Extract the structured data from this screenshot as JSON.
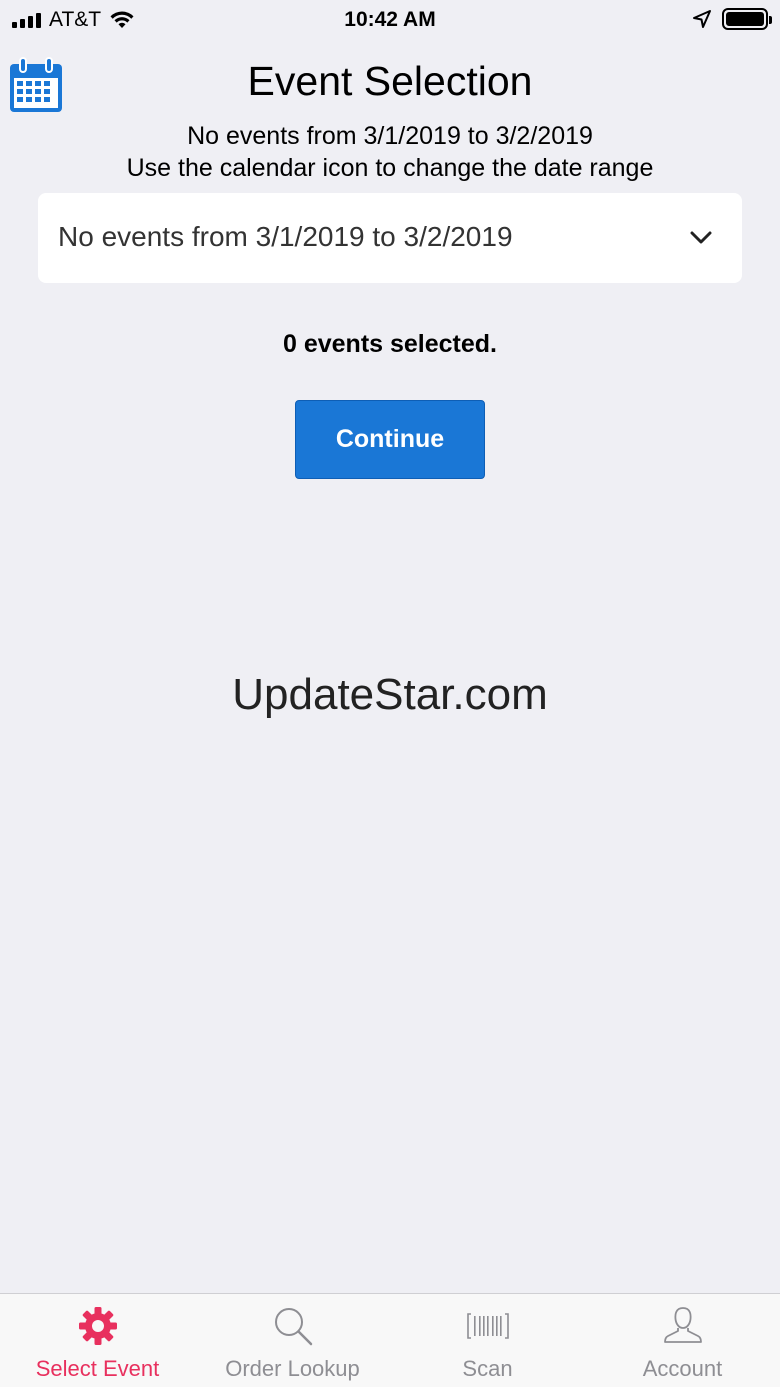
{
  "status_bar": {
    "carrier": "AT&T",
    "time": "10:42 AM"
  },
  "header": {
    "title": "Event Selection",
    "subtitle_line1": "No events from 3/1/2019 to 3/2/2019",
    "subtitle_line2": "Use the calendar icon to change the date range"
  },
  "event_dropdown": {
    "selected_value": "No events from 3/1/2019 to 3/2/2019"
  },
  "selection": {
    "count_text": "0 events selected."
  },
  "continue_button": {
    "label": "Continue"
  },
  "watermark": "UpdateStar.com",
  "tab_bar": {
    "tabs": [
      {
        "label": "Select Event",
        "icon": "gear-icon",
        "active": true
      },
      {
        "label": "Order Lookup",
        "icon": "search-icon",
        "active": false
      },
      {
        "label": "Scan",
        "icon": "barcode-icon",
        "active": false
      },
      {
        "label": "Account",
        "icon": "user-icon",
        "active": false
      }
    ]
  },
  "colors": {
    "accent": "#1a77d6",
    "active_tab": "#e8305e",
    "inactive_tab": "#8e8e93",
    "background": "#efeff4"
  }
}
